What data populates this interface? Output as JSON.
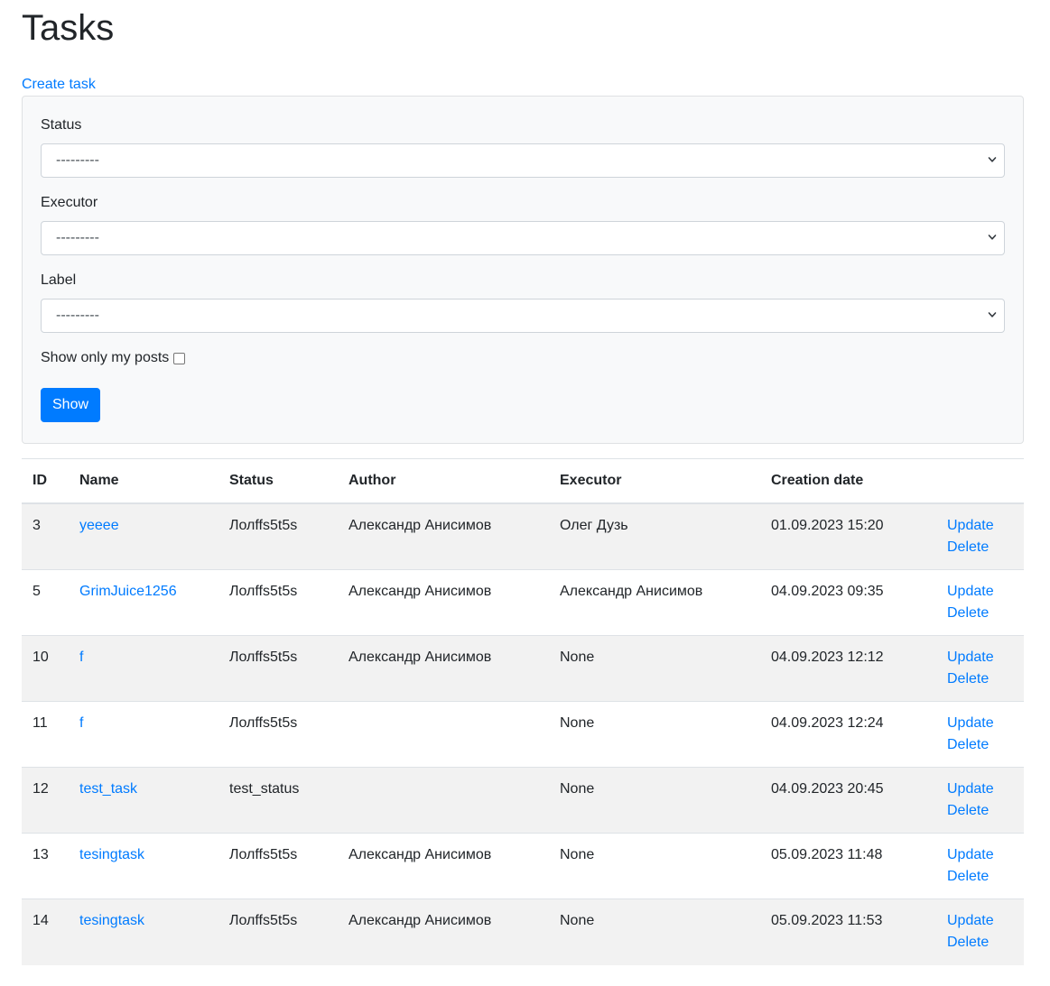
{
  "page": {
    "title": "Tasks",
    "create_link": "Create task"
  },
  "filter": {
    "status_label": "Status",
    "status_value": "---------",
    "executor_label": "Executor",
    "executor_value": "---------",
    "label_label": "Label",
    "label_value": "---------",
    "self_tasks_label": "Show only my posts",
    "self_tasks_checked": false,
    "submit_label": "Show"
  },
  "table": {
    "headers": [
      "ID",
      "Name",
      "Status",
      "Author",
      "Executor",
      "Creation date",
      ""
    ],
    "update_label": "Update",
    "delete_label": "Delete",
    "rows": [
      {
        "id": "3",
        "name": "yeeee",
        "status": "Лолffs5t5s",
        "author": "Александр Анисимов",
        "executor": "Олег Дузь",
        "created": "01.09.2023 15:20"
      },
      {
        "id": "5",
        "name": "GrimJuice1256",
        "status": "Лолffs5t5s",
        "author": "Александр Анисимов",
        "executor": "Александр Анисимов",
        "created": "04.09.2023 09:35"
      },
      {
        "id": "10",
        "name": "f",
        "status": "Лолffs5t5s",
        "author": "Александр Анисимов",
        "executor": "None",
        "created": "04.09.2023 12:12"
      },
      {
        "id": "11",
        "name": "f",
        "status": "Лолffs5t5s",
        "author": "",
        "executor": "None",
        "created": "04.09.2023 12:24"
      },
      {
        "id": "12",
        "name": "test_task",
        "status": "test_status",
        "author": "",
        "executor": "None",
        "created": "04.09.2023 20:45"
      },
      {
        "id": "13",
        "name": "tesingtask",
        "status": "Лолffs5t5s",
        "author": "Александр Анисимов",
        "executor": "None",
        "created": "05.09.2023 11:48"
      },
      {
        "id": "14",
        "name": "tesingtask",
        "status": "Лолffs5t5s",
        "author": "Александр Анисимов",
        "executor": "None",
        "created": "05.09.2023 11:53"
      }
    ]
  }
}
